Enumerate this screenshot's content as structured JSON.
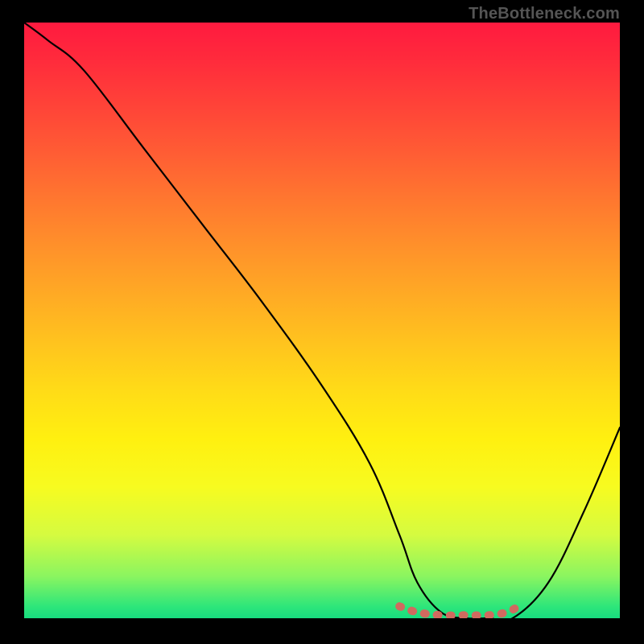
{
  "watermark": "TheBottleneck.com",
  "chart_data": {
    "type": "line",
    "title": "",
    "xlabel": "",
    "ylabel": "",
    "xlim": [
      0,
      100
    ],
    "ylim": [
      0,
      100
    ],
    "series": [
      {
        "name": "bottleneck-curve",
        "x": [
          0,
          4,
          10,
          20,
          30,
          40,
          50,
          58,
          63,
          66,
          70,
          74,
          78,
          82,
          88,
          94,
          100
        ],
        "y": [
          100,
          97,
          92,
          79,
          66,
          53,
          39,
          26,
          14,
          6,
          1,
          0,
          0,
          0,
          6,
          18,
          32
        ]
      },
      {
        "name": "optimum-band",
        "x": [
          63,
          66,
          70,
          74,
          78,
          81,
          83
        ],
        "y": [
          2,
          1,
          0.5,
          0.5,
          0.5,
          1,
          2
        ]
      }
    ],
    "colors": {
      "curve": "#000000",
      "optimum": "#d06a5f"
    }
  }
}
